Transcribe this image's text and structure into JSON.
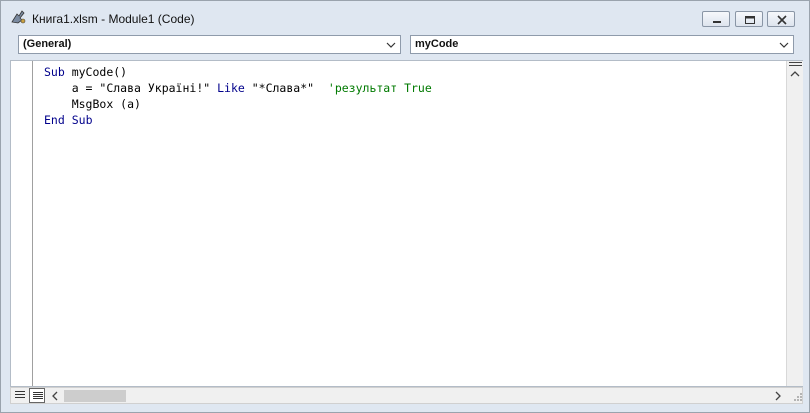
{
  "window": {
    "title": "Книга1.xlsm - Module1 (Code)"
  },
  "dropdowns": {
    "object": "(General)",
    "procedure": "myCode"
  },
  "code": {
    "line1": {
      "kw1": "Sub",
      "rest": " myCode()"
    },
    "line2": {
      "indent": "    ",
      "stmt": "a = \"Слава Україні!\" ",
      "kw": "Like",
      "rest": " \"*Слава*\"  ",
      "comment": "'результат True"
    },
    "line3": {
      "indent": "    ",
      "text": "MsgBox (a)"
    },
    "line4": {
      "kw1": "End",
      "space": " ",
      "kw2": "Sub"
    }
  },
  "colors": {
    "keyword": "#00008b",
    "comment": "#007a00"
  },
  "icons": {
    "app": "vba-module-icon",
    "minimize": "minimize-icon",
    "maximize": "maximize-icon",
    "close": "close-icon"
  }
}
